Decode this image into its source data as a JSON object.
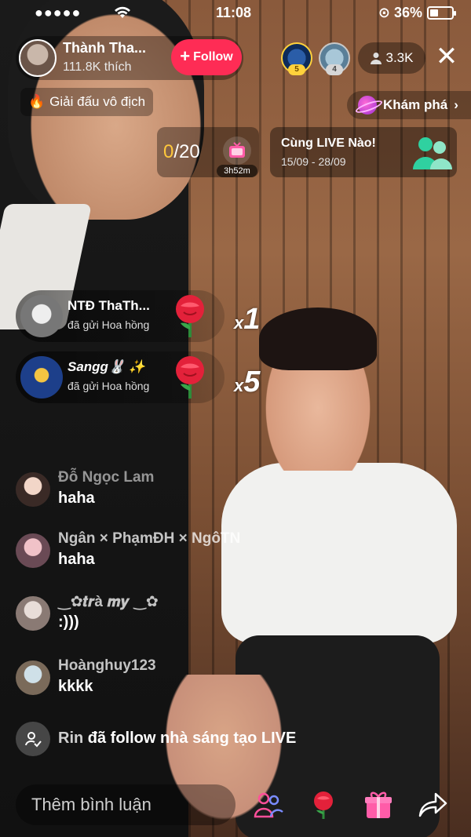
{
  "status_bar": {
    "time": "11:08",
    "battery": "36%",
    "battery_level": 0.36
  },
  "host": {
    "name": "Thành Tha...",
    "likes": "111.8K thích",
    "follow_label": "Follow"
  },
  "top_viewers": [
    {
      "rank": "5"
    },
    {
      "rank": "4"
    }
  ],
  "viewer_count": "3.3K",
  "tags": {
    "left": "Giải đấu vô địch",
    "right": "Khám phá"
  },
  "goal": {
    "current": "0",
    "target": "/20",
    "timer": "3h52m"
  },
  "event": {
    "title": "Cùng LIVE Nào!",
    "dates": "15/09 - 28/09"
  },
  "gifts": [
    {
      "sender": "NTĐ ThaTh...",
      "action": "đã gửi Hoa hồng",
      "count_prefix": "x",
      "count": "1"
    },
    {
      "sender": "Sangg🐰 ✨",
      "action": "đã gửi Hoa hồng",
      "count_prefix": "x",
      "count": "5"
    }
  ],
  "comments": [
    {
      "user": "Đỗ Ngọc Lam",
      "message": "haha"
    },
    {
      "user": "Ngân × PhạmĐH × NgôTN",
      "message": "haha"
    },
    {
      "user": "‿✿𝒕𝒓à 𝒎𝒚 ‿✿",
      "message": ":)))"
    },
    {
      "user": "Hoànghuy123",
      "message": "kkkk"
    }
  ],
  "system_note": {
    "user": "Rin",
    "text": " đã follow nhà sáng tạo LIVE"
  },
  "input": {
    "placeholder": "Thêm bình luận"
  },
  "icons": {
    "people": "people-icon",
    "rose": "rose-icon",
    "gift": "gift-icon",
    "share": "share-icon"
  },
  "colors": {
    "follow": "#fe2c55",
    "goal_current": "#ffc83c",
    "gold_rank": "#ffd23c"
  }
}
